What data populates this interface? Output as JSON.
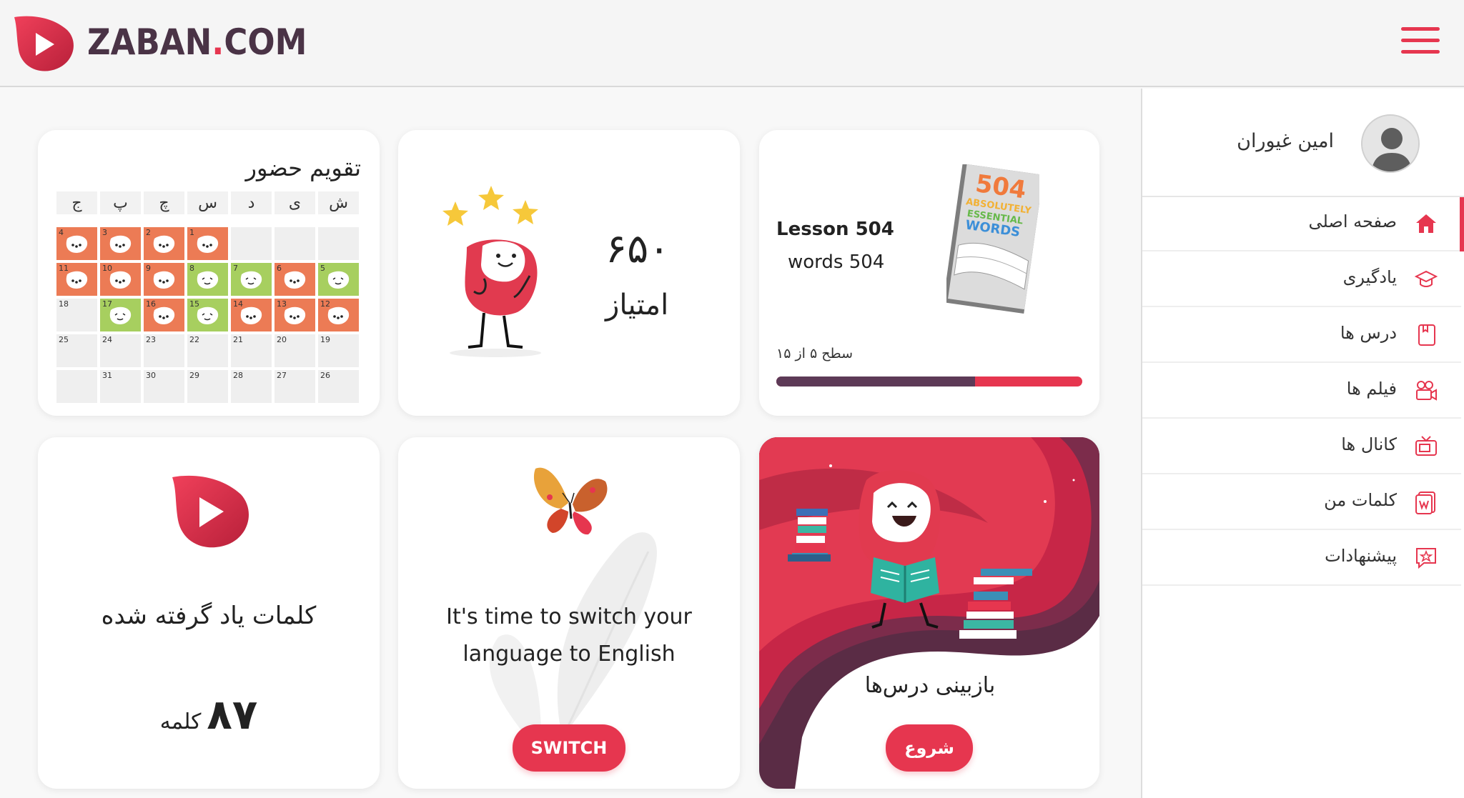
{
  "header": {
    "brand_main": "ZABAN",
    "brand_dot": ".",
    "brand_tld": "COM",
    "accent": "#e6364f",
    "brand_color": "#4a3346"
  },
  "sidebar": {
    "username": "امین غیوران",
    "items": [
      {
        "label": "صفحه اصلی",
        "icon": "home-icon",
        "active": true
      },
      {
        "label": "یادگیری",
        "icon": "graduation-cap-icon"
      },
      {
        "label": "درس ها",
        "icon": "book-icon"
      },
      {
        "label": "فیلم ها",
        "icon": "video-camera-icon"
      },
      {
        "label": "کانال ها",
        "icon": "tv-icon"
      },
      {
        "label": "کلمات من",
        "icon": "words-icon"
      },
      {
        "label": "پیشنهادات",
        "icon": "star-chat-icon"
      }
    ]
  },
  "lesson_card": {
    "title": "Lesson 504",
    "subtitle": "words 504",
    "level": "سطح ۵ از ۱۵",
    "progress": 0.65,
    "book_text": [
      "504",
      "ABSOLUTELY",
      "ESSENTIAL",
      "WORDS"
    ]
  },
  "score_card": {
    "value": "۶۵۰",
    "label": "امتیاز"
  },
  "calendar_card": {
    "title": "تقویم حضور",
    "weekdays": [
      "ج",
      "پ",
      "چ",
      "س",
      "د",
      "ی",
      "ش"
    ],
    "rows": [
      [
        {
          "n": "4",
          "s": "orange"
        },
        {
          "n": "3",
          "s": "orange"
        },
        {
          "n": "2",
          "s": "orange"
        },
        {
          "n": "1",
          "s": "orange"
        },
        {
          "n": "",
          "s": "empty"
        },
        {
          "n": "",
          "s": "empty"
        },
        {
          "n": "",
          "s": "empty"
        }
      ],
      [
        {
          "n": "11",
          "s": "orange"
        },
        {
          "n": "10",
          "s": "orange"
        },
        {
          "n": "9",
          "s": "orange"
        },
        {
          "n": "8",
          "s": "green"
        },
        {
          "n": "7",
          "s": "green"
        },
        {
          "n": "6",
          "s": "orange"
        },
        {
          "n": "5",
          "s": "green"
        }
      ],
      [
        {
          "n": "18",
          "s": "empty"
        },
        {
          "n": "17",
          "s": "green"
        },
        {
          "n": "16",
          "s": "orange"
        },
        {
          "n": "15",
          "s": "green"
        },
        {
          "n": "14",
          "s": "orange"
        },
        {
          "n": "13",
          "s": "orange"
        },
        {
          "n": "12",
          "s": "orange"
        }
      ],
      [
        {
          "n": "25",
          "s": "empty"
        },
        {
          "n": "24",
          "s": "empty"
        },
        {
          "n": "23",
          "s": "empty"
        },
        {
          "n": "22",
          "s": "empty"
        },
        {
          "n": "21",
          "s": "empty"
        },
        {
          "n": "20",
          "s": "empty"
        },
        {
          "n": "19",
          "s": "empty"
        }
      ],
      [
        {
          "n": "",
          "s": "empty"
        },
        {
          "n": "31",
          "s": "empty"
        },
        {
          "n": "30",
          "s": "empty"
        },
        {
          "n": "29",
          "s": "empty"
        },
        {
          "n": "28",
          "s": "empty"
        },
        {
          "n": "27",
          "s": "empty"
        },
        {
          "n": "26",
          "s": "empty"
        }
      ]
    ]
  },
  "review_card": {
    "label": "بازبینی درس‌ها",
    "button": "شروع"
  },
  "switch_card": {
    "text_line1": "It's time to switch your",
    "text_line2": "language to English",
    "button": "SWITCH"
  },
  "words_card": {
    "title": "کلمات یاد گرفته شده",
    "count": "۸۷",
    "unit": "کلمه"
  }
}
